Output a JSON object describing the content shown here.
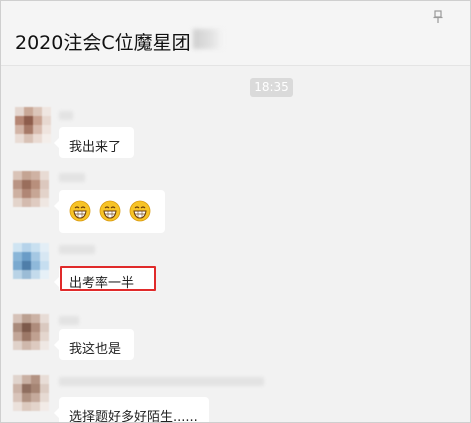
{
  "chat": {
    "title": "2020注会C位魔星团",
    "time_label": "18:35"
  },
  "messages": [
    {
      "type": "text",
      "text": "我出来了"
    },
    {
      "type": "emoji",
      "emojis": [
        "grin-emoji",
        "grin-emoji",
        "grin-emoji"
      ]
    },
    {
      "type": "text",
      "text": "出考率一半"
    },
    {
      "type": "text",
      "text": "我这也是"
    },
    {
      "type": "text",
      "text": "选择题好多好陌生......"
    }
  ],
  "colors": {
    "highlight": "#e02a2a",
    "background": "#f2f2f2",
    "bubble": "#ffffff"
  }
}
